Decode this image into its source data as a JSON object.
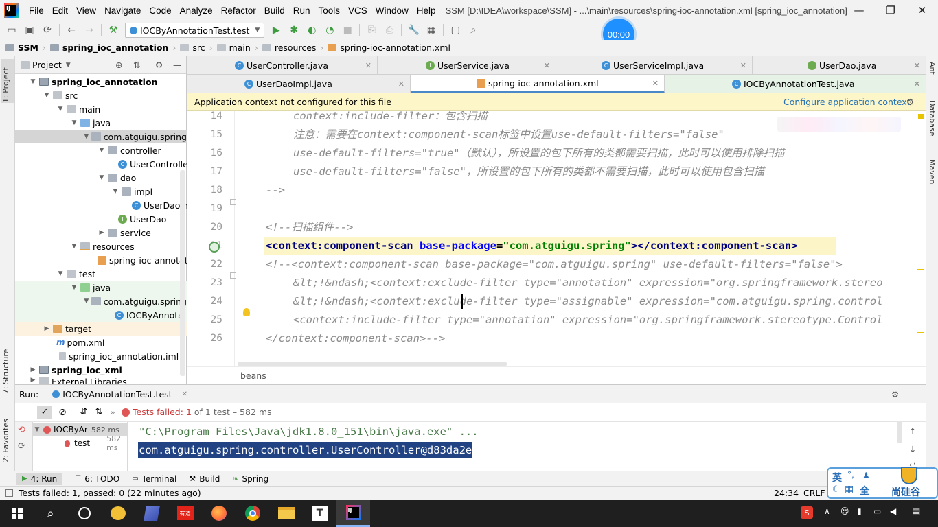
{
  "menubar": {
    "items": [
      "File",
      "Edit",
      "View",
      "Navigate",
      "Code",
      "Analyze",
      "Refactor",
      "Build",
      "Run",
      "Tools",
      "VCS",
      "Window",
      "Help"
    ],
    "title": "SSM [D:\\IDEA\\workspace\\SSM] - ...\\main\\resources\\spring-ioc-annotation.xml [spring_ioc_annotation]"
  },
  "toolbar": {
    "run_config": "IOCByAnnotationTest.test",
    "timer": "00:00"
  },
  "breadcrumbs": [
    "SSM",
    "spring_ioc_annotation",
    "src",
    "main",
    "resources",
    "spring-ioc-annotation.xml"
  ],
  "left_strip": {
    "project_tab": "1: Project",
    "structure_tab": "7: Structure",
    "favorites_tab": "2: Favorites"
  },
  "right_strip": {
    "ant_tab": "Ant",
    "database_tab": "Database",
    "maven_tab": "Maven"
  },
  "project_panel": {
    "header": "Project",
    "tree": [
      {
        "label": "spring_ioc_annotation",
        "bold": true
      },
      {
        "label": "src"
      },
      {
        "label": "main"
      },
      {
        "label": "java"
      },
      {
        "label": "com.atguigu.spring"
      },
      {
        "label": "controller"
      },
      {
        "label": "UserController"
      },
      {
        "label": "dao"
      },
      {
        "label": "impl"
      },
      {
        "label": "UserDaoImpl"
      },
      {
        "label": "UserDao"
      },
      {
        "label": "service"
      },
      {
        "label": "resources"
      },
      {
        "label": "spring-ioc-annotation.xml"
      },
      {
        "label": "test"
      },
      {
        "label": "java"
      },
      {
        "label": "com.atguigu.spring"
      },
      {
        "label": "IOCByAnnotationTest"
      },
      {
        "label": "target"
      },
      {
        "label": "pom.xml"
      },
      {
        "label": "spring_ioc_annotation.iml"
      },
      {
        "label": "spring_ioc_xml",
        "bold": true
      },
      {
        "label": "External Libraries"
      }
    ]
  },
  "editor": {
    "tabs_row1": [
      "UserController.java",
      "UserService.java",
      "UserServiceImpl.java",
      "UserDao.java"
    ],
    "tabs_row2": [
      "UserDaoImpl.java",
      "spring-ioc-annotation.xml",
      "IOCByAnnotationTest.java"
    ],
    "active_tab": "spring-ioc-annotation.xml",
    "banner_text": "Application context not configured for this file",
    "banner_link": "Configure application context",
    "line_numbers": [
      "14",
      "15",
      "16",
      "17",
      "18",
      "19",
      "20",
      "21",
      "22",
      "23",
      "24",
      "25",
      "26"
    ],
    "lines": {
      "l14": "context:include-filter：包含扫描",
      "l15": "注意：需要在context:component-scan标签中设置use-default-filters=\"false\"",
      "l16": "use-default-filters=\"true\"（默认），所设置的包下所有的类都需要扫描，此时可以使用排除扫描",
      "l17": "use-default-filters=\"false\"，所设置的包下所有的类都不需要扫描，此时可以使用包含扫描",
      "l18": "-->",
      "l20": "<!--扫描组件-->",
      "l21_open": "<context:component-scan ",
      "l21_attr": "base-package",
      "l21_eq": "=",
      "l21_val": "\"com.atguigu.spring\"",
      "l21_close": "></context:component-scan>",
      "l22": "<!--<context:component-scan base-package=\"com.atguigu.spring\" use-default-filters=\"false\">",
      "l23": "&lt;!&ndash;<context:exclude-filter type=\"annotation\" expression=\"org.springframework.stereo",
      "l24": "&lt;!&ndash;<context:exclude-filter type=\"assignable\" expression=\"com.atguigu.spring.control",
      "l25": "<context:include-filter type=\"annotation\" expression=\"org.springframework.stereotype.Control",
      "l26": "</context:component-scan>-->"
    },
    "breadcrumb": "beans"
  },
  "run_panel": {
    "label": "Run:",
    "config": "IOCByAnnotationTest.test",
    "status": "Tests failed:",
    "failed_count": "1",
    "of_text": "of 1 test – 582 ms",
    "tree": [
      {
        "label": "IOCByAr",
        "time": "582 ms"
      },
      {
        "label": "test",
        "time": "582 ms"
      }
    ],
    "console": [
      "\"C:\\Program Files\\Java\\jdk1.8.0_151\\bin\\java.exe\" ...",
      "com.atguigu.spring.controller.UserController@d83da2e"
    ]
  },
  "bottom_tabs": [
    "4: Run",
    "6: TODO",
    "Terminal",
    "Build",
    "Spring"
  ],
  "status": {
    "message": "Tests failed: 1, passed: 0 (22 minutes ago)",
    "position": "24:34",
    "line_sep": "CRLF"
  },
  "ime": {
    "lang": "英",
    "mode": "全",
    "brand": "尚硅谷"
  },
  "colors": {
    "accent": "#4a88c7",
    "banner_bg": "#fdf6c8",
    "xml_tag": "#000080",
    "xml_attr": "#0000ff",
    "xml_value": "#008000",
    "comment": "#8c8c8c",
    "error": "#e05555",
    "selection": "#214283"
  }
}
